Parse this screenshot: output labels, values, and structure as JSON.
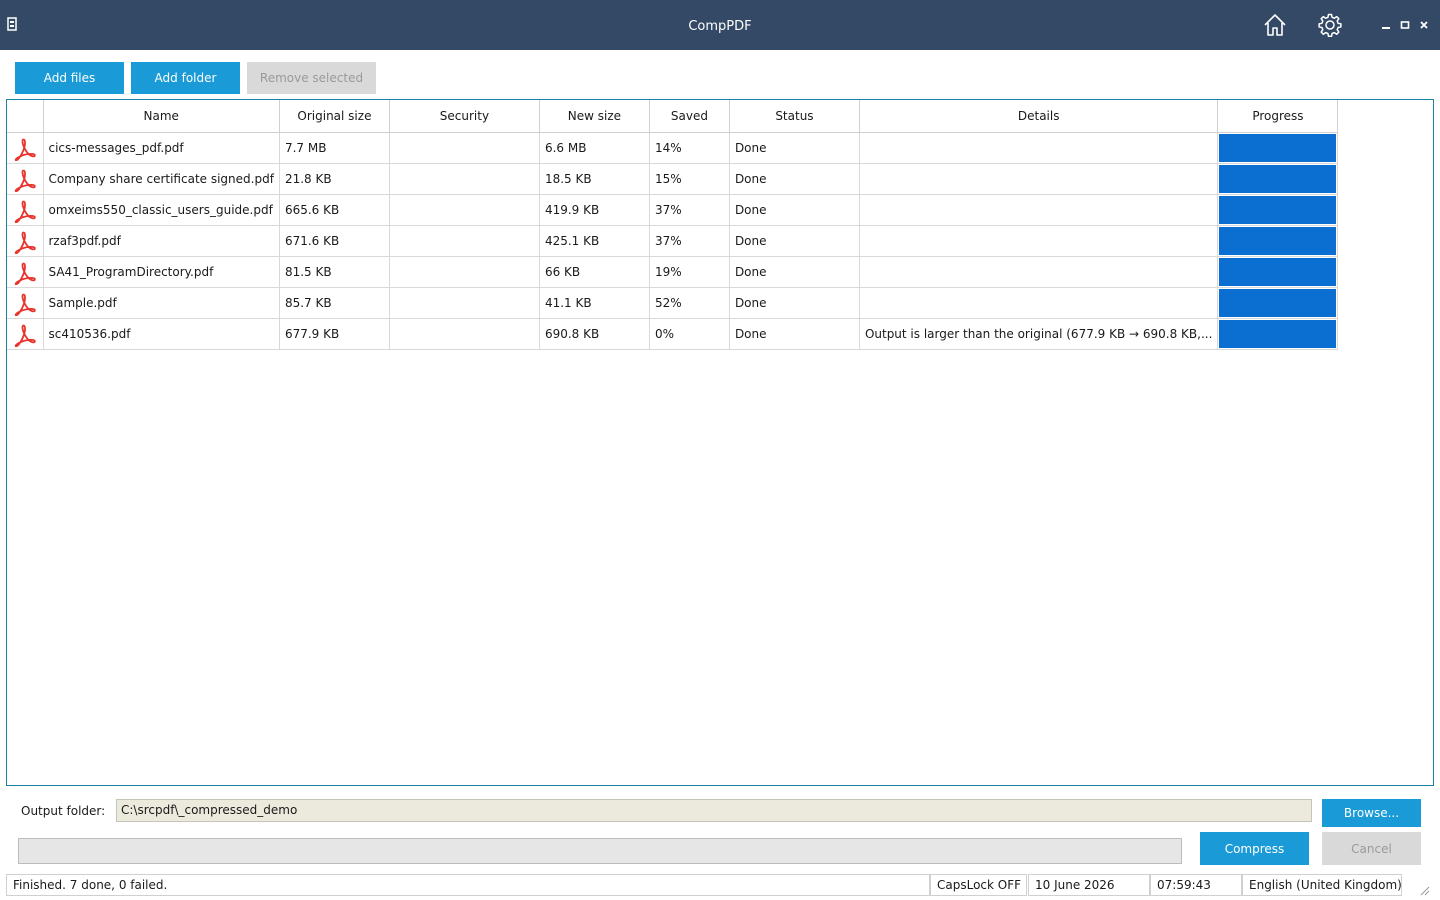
{
  "window": {
    "title": "CompPDF"
  },
  "toolbar": {
    "add_files": "Add files",
    "add_folder": "Add folder",
    "remove_selected": "Remove selected"
  },
  "table": {
    "headers": [
      "",
      "Name",
      "Original size",
      "Security",
      "New size",
      "Saved",
      "Status",
      "Details",
      "Progress"
    ],
    "rows": [
      {
        "name": "cics-messages_pdf.pdf",
        "original_size": "7.7 MB",
        "security": "",
        "new_size": "6.6 MB",
        "saved": "14%",
        "status": "Done",
        "details": "",
        "progress": 1.0
      },
      {
        "name": "Company share certificate signed.pdf",
        "original_size": "21.8 KB",
        "security": "",
        "new_size": "18.5 KB",
        "saved": "15%",
        "status": "Done",
        "details": "",
        "progress": 1.0
      },
      {
        "name": "omxeims550_classic_users_guide.pdf",
        "original_size": "665.6 KB",
        "security": "",
        "new_size": "419.9 KB",
        "saved": "37%",
        "status": "Done",
        "details": "",
        "progress": 1.0
      },
      {
        "name": "rzaf3pdf.pdf",
        "original_size": "671.6 KB",
        "security": "",
        "new_size": "425.1 KB",
        "saved": "37%",
        "status": "Done",
        "details": "",
        "progress": 1.0
      },
      {
        "name": "SA41_ProgramDirectory.pdf",
        "original_size": "81.5 KB",
        "security": "",
        "new_size": "66 KB",
        "saved": "19%",
        "status": "Done",
        "details": "",
        "progress": 1.0
      },
      {
        "name": "Sample.pdf",
        "original_size": "85.7 KB",
        "security": "",
        "new_size": "41.1 KB",
        "saved": "52%",
        "status": "Done",
        "details": "",
        "progress": 1.0
      },
      {
        "name": "sc410536.pdf",
        "original_size": "677.9 KB",
        "security": "",
        "new_size": "690.8 KB",
        "saved": "0%",
        "status": "Done",
        "details": "Output is larger than the original (677.9 KB → 690.8 KB,...",
        "progress": 1.0
      }
    ]
  },
  "output": {
    "label": "Output folder:",
    "path": "C:\\srcpdf\\_compressed_demo",
    "browse": "Browse..."
  },
  "actions": {
    "compress": "Compress",
    "cancel": "Cancel",
    "overall_progress": 0
  },
  "status": {
    "message": "Finished. 7 done, 0 failed.",
    "capslock": "CapsLock OFF",
    "date": "10 June 2026",
    "time": "07:59:43",
    "language": "English (United Kingdom)"
  },
  "icons": {
    "row_icon": "pdf-file-icon",
    "home": "home-icon",
    "settings": "gear-icon"
  },
  "colors": {
    "titlebar": "#344966",
    "accent": "#1a9bd7",
    "progress_fill": "#0a6fd0",
    "pdf_icon": "#e8342c"
  }
}
